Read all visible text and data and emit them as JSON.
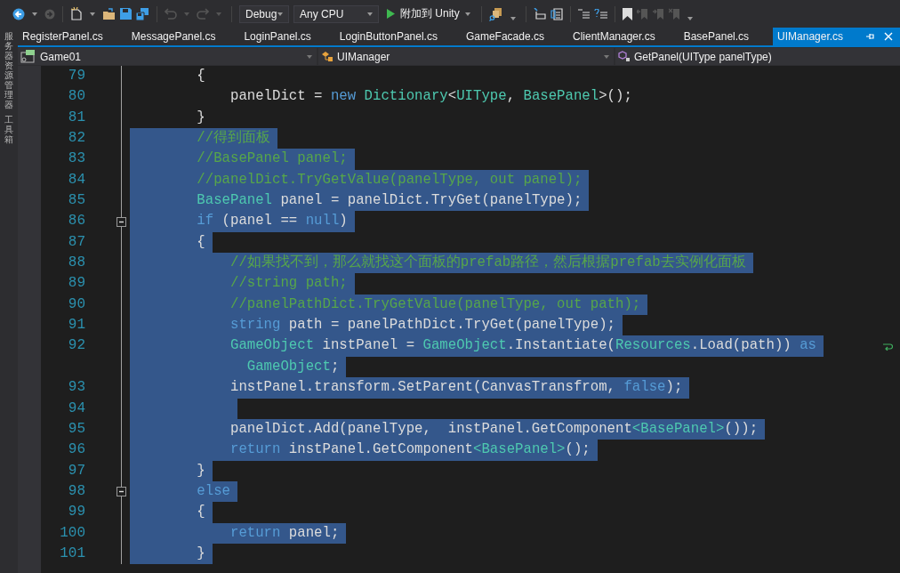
{
  "side_panels": [
    {
      "label": "服务器资源管理器"
    },
    {
      "label": "工具箱"
    }
  ],
  "toolbar": {
    "configuration": "Debug",
    "platform": "Any CPU",
    "start_button": "附加到 Unity"
  },
  "tabs": [
    {
      "label": "RegisterPanel.cs",
      "selected": false
    },
    {
      "label": "MessagePanel.cs",
      "selected": false
    },
    {
      "label": "LoginPanel.cs",
      "selected": false
    },
    {
      "label": "LoginButtonPanel.cs",
      "selected": false
    },
    {
      "label": "GameFacade.cs",
      "selected": false
    },
    {
      "label": "ClientManager.cs",
      "selected": false
    },
    {
      "label": "BasePanel.cs",
      "selected": false
    },
    {
      "label": "UIManager.cs",
      "selected": true
    }
  ],
  "navigation_bar": {
    "project": "Game01",
    "class": "UIManager",
    "member": "GetPanel(UIType panelType)"
  },
  "code_lines": [
    {
      "number": "79",
      "selected": false,
      "fold": false,
      "wrapped": false,
      "tokens": [
        {
          "text": "        {",
          "kind": "plain"
        }
      ]
    },
    {
      "number": "80",
      "selected": false,
      "fold": false,
      "wrapped": false,
      "tokens": [
        {
          "text": "            panelDict = ",
          "kind": "plain"
        },
        {
          "text": "new ",
          "kind": "keyword"
        },
        {
          "text": "Dictionary",
          "kind": "type"
        },
        {
          "text": "<",
          "kind": "plain"
        },
        {
          "text": "UIType",
          "kind": "type"
        },
        {
          "text": ", ",
          "kind": "plain"
        },
        {
          "text": "BasePanel",
          "kind": "type"
        },
        {
          "text": ">();",
          "kind": "plain"
        }
      ]
    },
    {
      "number": "81",
      "selected": false,
      "fold": false,
      "wrapped": false,
      "tokens": [
        {
          "text": "        }",
          "kind": "plain"
        }
      ]
    },
    {
      "number": "82",
      "selected": true,
      "fold": false,
      "wrapped": false,
      "tokens": [
        {
          "text": "        //得到面板",
          "kind": "comment"
        }
      ]
    },
    {
      "number": "83",
      "selected": true,
      "fold": false,
      "wrapped": false,
      "tokens": [
        {
          "text": "        //BasePanel panel;",
          "kind": "comment"
        }
      ]
    },
    {
      "number": "84",
      "selected": true,
      "fold": false,
      "wrapped": false,
      "tokens": [
        {
          "text": "        //panelDict.TryGetValue(panelType, out panel);",
          "kind": "comment"
        }
      ]
    },
    {
      "number": "85",
      "selected": true,
      "fold": false,
      "wrapped": false,
      "tokens": [
        {
          "text": "        BasePanel",
          "kind": "type"
        },
        {
          "text": " panel = panelDict.TryGet(panelType);",
          "kind": "plain"
        }
      ]
    },
    {
      "number": "86",
      "selected": true,
      "fold": true,
      "wrapped": false,
      "tokens": [
        {
          "text": "        if",
          "kind": "keyword"
        },
        {
          "text": " (panel == ",
          "kind": "plain"
        },
        {
          "text": "null",
          "kind": "keyword"
        },
        {
          "text": ")",
          "kind": "plain"
        }
      ]
    },
    {
      "number": "87",
      "selected": true,
      "fold": false,
      "wrapped": false,
      "tokens": [
        {
          "text": "        {",
          "kind": "plain"
        }
      ]
    },
    {
      "number": "88",
      "selected": true,
      "fold": false,
      "wrapped": false,
      "tokens": [
        {
          "text": "            //如果找不到，那么就找这个面板的prefab路径，然后根据prefab去实例化面板",
          "kind": "comment"
        }
      ]
    },
    {
      "number": "89",
      "selected": true,
      "fold": false,
      "wrapped": false,
      "tokens": [
        {
          "text": "            //string path;",
          "kind": "comment"
        }
      ]
    },
    {
      "number": "90",
      "selected": true,
      "fold": false,
      "wrapped": false,
      "tokens": [
        {
          "text": "            //panelPathDict.TryGetValue(panelType, out path);",
          "kind": "comment"
        }
      ]
    },
    {
      "number": "91",
      "selected": true,
      "fold": false,
      "wrapped": false,
      "tokens": [
        {
          "text": "            string",
          "kind": "keyword"
        },
        {
          "text": " path = panelPathDict.TryGet(panelType);",
          "kind": "plain"
        }
      ]
    },
    {
      "number": "92",
      "selected": true,
      "fold": false,
      "wrapped": true,
      "tokens": [
        {
          "text": "            GameObject",
          "kind": "type"
        },
        {
          "text": " instPanel = ",
          "kind": "plain"
        },
        {
          "text": "GameObject",
          "kind": "type"
        },
        {
          "text": ".Instantiate(",
          "kind": "plain"
        },
        {
          "text": "Resources",
          "kind": "type"
        },
        {
          "text": ".Load(path)) ",
          "kind": "plain"
        },
        {
          "text": "as",
          "kind": "keyword"
        }
      ]
    },
    {
      "selected": true,
      "fold": false,
      "wrapped": false,
      "tokens": [
        {
          "text": "              GameObject",
          "kind": "type"
        },
        {
          "text": ";",
          "kind": "plain"
        }
      ]
    },
    {
      "number": "93",
      "selected": true,
      "fold": false,
      "wrapped": false,
      "tokens": [
        {
          "text": "            instPanel.transform.SetParent(CanvasTransfrom, ",
          "kind": "plain"
        },
        {
          "text": "false",
          "kind": "keyword"
        },
        {
          "text": ");",
          "kind": "plain"
        }
      ]
    },
    {
      "number": "94",
      "selected": true,
      "fold": false,
      "wrapped": false
    },
    {
      "number": "95",
      "selected": true,
      "fold": false,
      "wrapped": false,
      "tokens": [
        {
          "text": "            panelDict.Add(panelType,  instPanel.GetComponent",
          "kind": "plain"
        },
        {
          "text": "<BasePanel>",
          "kind": "type"
        },
        {
          "text": "());",
          "kind": "plain"
        }
      ]
    },
    {
      "number": "96",
      "selected": true,
      "fold": false,
      "wrapped": false,
      "tokens": [
        {
          "text": "            return",
          "kind": "keyword"
        },
        {
          "text": " instPanel.GetComponent",
          "kind": "plain"
        },
        {
          "text": "<BasePanel>",
          "kind": "type"
        },
        {
          "text": "();",
          "kind": "plain"
        }
      ]
    },
    {
      "number": "97",
      "selected": true,
      "fold": false,
      "wrapped": false,
      "tokens": [
        {
          "text": "        }",
          "kind": "plain"
        }
      ]
    },
    {
      "number": "98",
      "selected": true,
      "fold": true,
      "wrapped": false,
      "tokens": [
        {
          "text": "        else",
          "kind": "keyword"
        }
      ]
    },
    {
      "number": "99",
      "selected": true,
      "fold": false,
      "wrapped": false,
      "tokens": [
        {
          "text": "        {",
          "kind": "plain"
        }
      ]
    },
    {
      "number": "100",
      "selected": true,
      "fold": false,
      "wrapped": false,
      "tokens": [
        {
          "text": "            return",
          "kind": "keyword"
        },
        {
          "text": " panel;",
          "kind": "plain"
        }
      ]
    },
    {
      "number": "101",
      "selected": true,
      "fold": false,
      "wrapped": false,
      "tokens": [
        {
          "text": "        }",
          "kind": "plain"
        }
      ]
    }
  ]
}
